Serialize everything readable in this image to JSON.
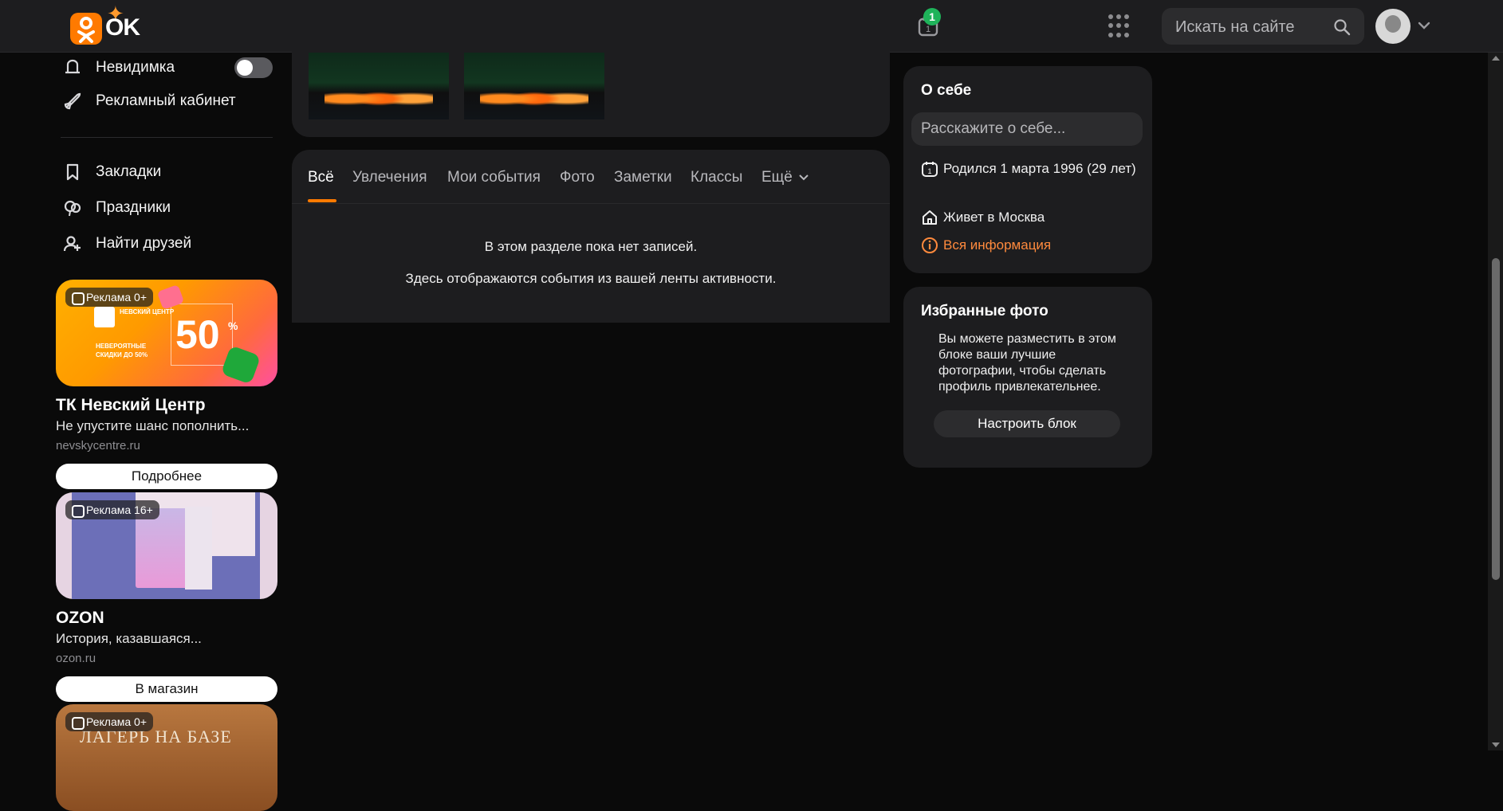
{
  "header": {
    "logo_text": "OK",
    "notification_count": "1",
    "search_placeholder": "Искать на сайте",
    "nav_icons": [
      "mail-icon",
      "chat-icon",
      "bell-icon",
      "footprints-icon",
      "like-icon",
      "video-camera-icon",
      "music-icon",
      "video-play-icon",
      "calendar-icon"
    ]
  },
  "sidebar": {
    "invisible_label": "Невидимка",
    "ads_cabinet_label": "Рекламный кабинет",
    "bookmarks_label": "Закладки",
    "holidays_label": "Праздники",
    "find_friends_label": "Найти друзей"
  },
  "ads": [
    {
      "label": "Реклама 0+",
      "title": "ТК Невский Центр",
      "desc": "Не упустите шанс пополнить...",
      "domain": "nevskycentre.ru",
      "button": "Подробнее",
      "banner_brand": "НЕВСКИЙ ЦЕНТР",
      "banner_text": "НЕВЕРОЯТНЫЕ СКИДКИ ДО 50%",
      "banner_percent": "50"
    },
    {
      "label": "Реклама 16+",
      "title": "OZON",
      "desc": "История, казавшаяся...",
      "domain": "ozon.ru",
      "button": "В магазин"
    },
    {
      "label": "Реклама 0+",
      "banner_text": "ЛАГЕРЬ НА БАЗЕ"
    }
  ],
  "feed": {
    "tabs": [
      "Всё",
      "Увлечения",
      "Мои события",
      "Фото",
      "Заметки",
      "Классы",
      "Ещё"
    ],
    "active_tab": "Всё",
    "empty_title": "В этом разделе пока нет записей.",
    "empty_subtitle": "Здесь отображаются события из вашей ленты активности."
  },
  "about": {
    "title": "О себе",
    "placeholder": "Расскажите о себе...",
    "birth": "Родился 1 марта 1996 (29 лет)",
    "lives": "Живет в Москва",
    "all_info": "Вся информация"
  },
  "favorites": {
    "title": "Избранные фото",
    "text": "Вы можете разместить в этом блоке ваши лучшие фотографии, чтобы сделать профиль привлекательнее.",
    "button": "Настроить блок"
  },
  "colors": {
    "accent": "#ff7a00",
    "badge": "#1fb35a",
    "link": "#ff8a3d"
  }
}
